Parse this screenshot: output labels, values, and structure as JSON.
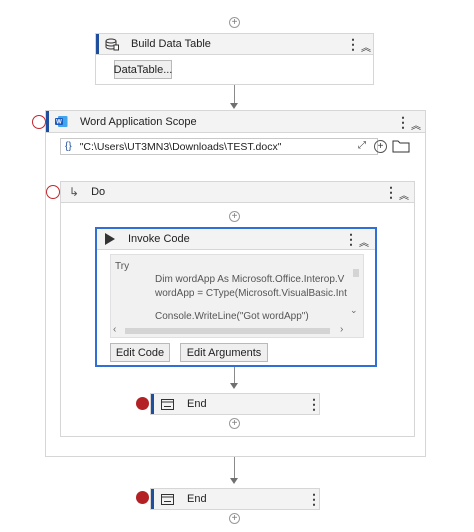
{
  "build_data_table": {
    "title": "Build Data Table",
    "button_label": "DataTable...",
    "icon": "data-table-icon"
  },
  "word_scope": {
    "title": "Word Application Scope",
    "path_value": "\"C:\\Users\\UT3MN3\\Downloads\\TEST.docx\"",
    "icon": "word-icon"
  },
  "do_sequence": {
    "title": "Do"
  },
  "invoke_code": {
    "title": "Invoke Code",
    "code_lines": [
      "Try",
      "Dim wordApp As Microsoft.Office.Interop.V",
      "wordApp = CType(Microsoft.VisualBasic.Int",
      "Console.WriteLine(\"Got wordApp\")"
    ],
    "edit_code_label": "Edit Code",
    "edit_arguments_label": "Edit Arguments"
  },
  "end_inner": {
    "title": "End"
  },
  "end_outer": {
    "title": "End"
  },
  "colors": {
    "accent": "#1f4e9c",
    "selected_border": "#2f6fd6",
    "breakpoint": "#b42125",
    "header_bg": "#f3f3f3"
  }
}
